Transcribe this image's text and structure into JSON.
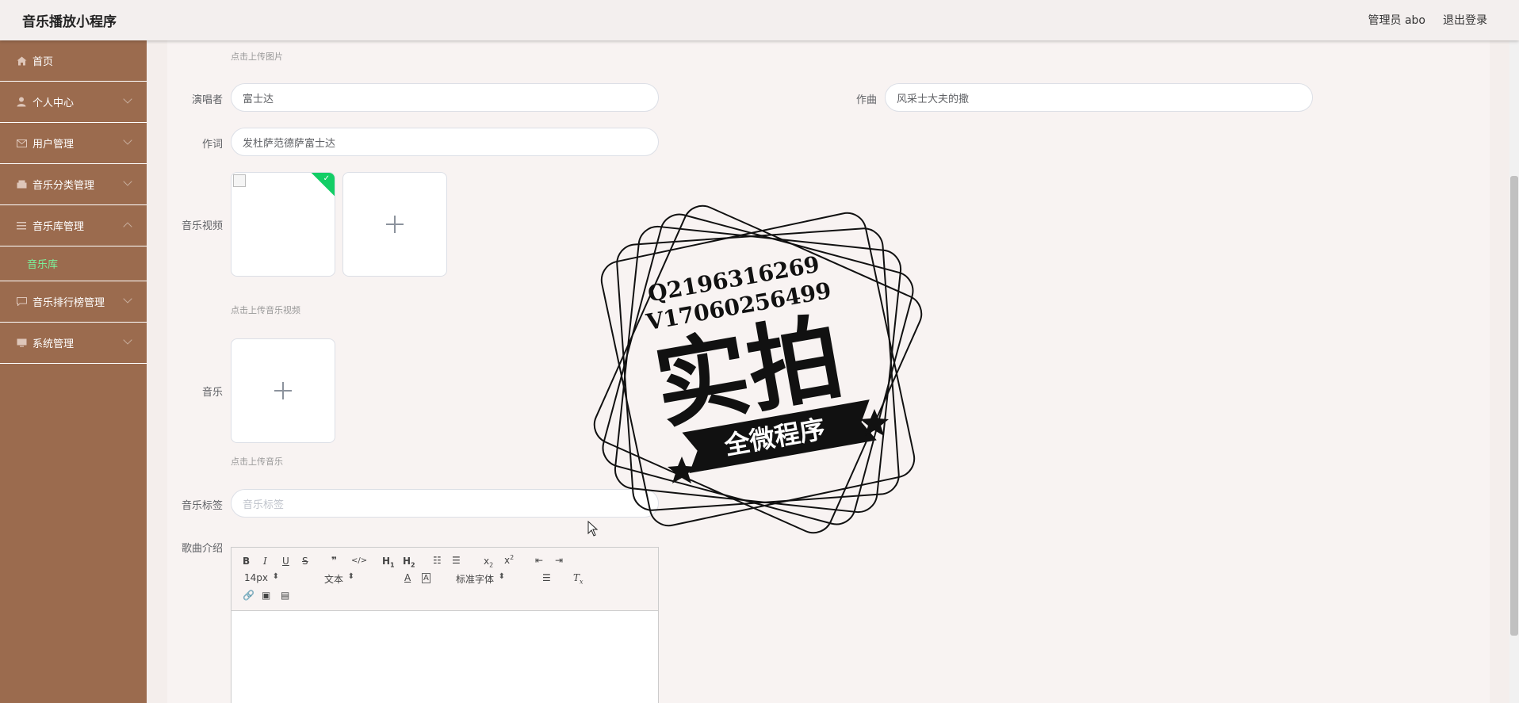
{
  "header": {
    "title": "音乐播放小程序",
    "admin": "管理员 abo",
    "logout": "退出登录"
  },
  "sidebar": {
    "items": [
      {
        "label": "首页",
        "icon": "home-icon"
      },
      {
        "label": "个人中心",
        "icon": "user-icon"
      },
      {
        "label": "用户管理",
        "icon": "mail-icon"
      },
      {
        "label": "音乐分类管理",
        "icon": "box-icon"
      },
      {
        "label": "音乐库管理",
        "icon": "menu-icon"
      },
      {
        "label": "音乐排行榜管理",
        "icon": "chat-icon"
      },
      {
        "label": "系统管理",
        "icon": "monitor-icon"
      }
    ],
    "sub_active": "音乐库"
  },
  "form": {
    "upload_image_hint": "点击上传图片",
    "singer_label": "演唱者",
    "singer_value": "富士达",
    "composer_label": "作曲",
    "composer_value": "风采士大夫的撒",
    "lyricist_label": "作词",
    "lyricist_value": "发杜萨范德萨富士达",
    "video_label": "音乐视频",
    "video_hint": "点击上传音乐视频",
    "music_label": "音乐",
    "music_hint": "点击上传音乐",
    "tag_label": "音乐标签",
    "tag_placeholder": "音乐标签",
    "intro_label": "歌曲介绍"
  },
  "editor": {
    "font_size": "14px",
    "text_style": "文本",
    "font_family": "标准字体"
  },
  "watermark": {
    "line1": "Q2196316269",
    "line2": "V17060256499",
    "main": "实拍",
    "banner": "全微程序"
  },
  "colors": {
    "sidebar_bg": "#9b6b4e",
    "active_sub": "#7cf29b",
    "success": "#13ce66"
  }
}
